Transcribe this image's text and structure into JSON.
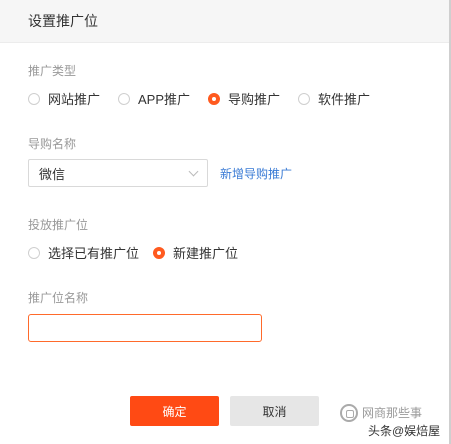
{
  "dialog": {
    "title": "设置推广位"
  },
  "promo_type": {
    "label": "推广类型",
    "options": [
      {
        "label": "网站推广",
        "checked": false
      },
      {
        "label": "APP推广",
        "checked": false
      },
      {
        "label": "导购推广",
        "checked": true
      },
      {
        "label": "软件推广",
        "checked": false
      }
    ]
  },
  "guide_name": {
    "label": "导购名称",
    "selected": "微信",
    "add_link": "新增导购推广"
  },
  "placement": {
    "label": "投放推广位",
    "options": [
      {
        "label": "选择已有推广位",
        "checked": false
      },
      {
        "label": "新建推广位",
        "checked": true
      }
    ]
  },
  "placement_name": {
    "label": "推广位名称",
    "value": ""
  },
  "buttons": {
    "ok": "确定",
    "cancel": "取消"
  },
  "watermark": {
    "line1": "网商那些事",
    "line2": "头条@娱焙屋"
  },
  "colors": {
    "accent": "#ff4a14",
    "link": "#3a7bd5"
  }
}
